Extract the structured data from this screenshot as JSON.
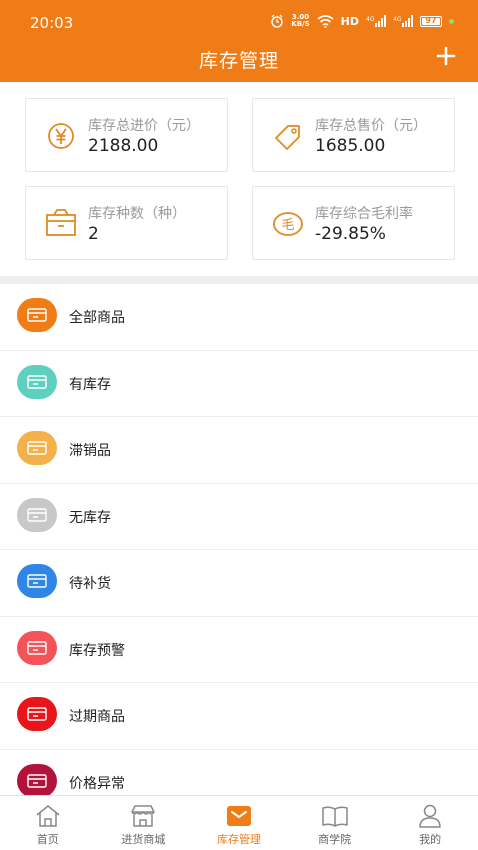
{
  "status_bar": {
    "time": "20:03",
    "net_speed_top": "3.00",
    "net_speed_bottom": "KB/S",
    "hd_label": "HD",
    "battery": "97"
  },
  "header": {
    "title": "库存管理",
    "add_icon": "plus-icon"
  },
  "summary": [
    {
      "label": "库存总进价（元）",
      "value": "2188.00",
      "icon": "yen-coin-icon"
    },
    {
      "label": "库存总售价（元）",
      "value": "1685.00",
      "icon": "price-tag-icon"
    },
    {
      "label": "库存种数（种）",
      "value": "2",
      "icon": "box-icon"
    },
    {
      "label": "库存综合毛利率",
      "value": "-29.85%",
      "icon": "mao-coin-icon"
    }
  ],
  "categories": [
    {
      "label": "全部商品",
      "color": "#f07c17"
    },
    {
      "label": "有库存",
      "color": "#5fcfc0"
    },
    {
      "label": "滞销品",
      "color": "#f4b04a"
    },
    {
      "label": "无库存",
      "color": "#c8c8c8"
    },
    {
      "label": "待补货",
      "color": "#2f86e6"
    },
    {
      "label": "库存预警",
      "color": "#f5535a"
    },
    {
      "label": "过期商品",
      "color": "#e8151b"
    },
    {
      "label": "价格异常",
      "color": "#b3123a"
    }
  ],
  "tabs": [
    {
      "label": "首页",
      "icon": "home-icon",
      "active": false
    },
    {
      "label": "进货商城",
      "icon": "store-icon",
      "active": false
    },
    {
      "label": "库存管理",
      "icon": "inventory-icon",
      "active": true
    },
    {
      "label": "商学院",
      "icon": "book-icon",
      "active": false
    },
    {
      "label": "我的",
      "icon": "user-icon",
      "active": false
    }
  ],
  "colors": {
    "accent": "#f07c17",
    "muted_text": "#9a9a9a",
    "divider": "#eeeeee"
  }
}
